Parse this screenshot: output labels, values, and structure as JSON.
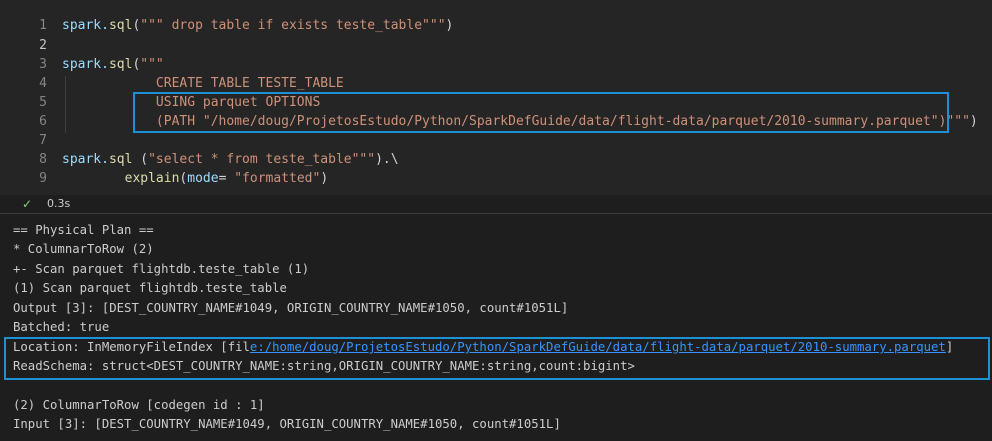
{
  "cell": {
    "lines": [
      {
        "n": "1",
        "parts": [
          {
            "t": "spark.",
            "c": "id"
          },
          {
            "t": "sql",
            "c": "fn"
          },
          {
            "t": "(",
            "c": "pn"
          },
          {
            "t": "\"\"\" drop table if exists teste_table\"\"\"",
            "c": "st"
          },
          {
            "t": ")",
            "c": "pn"
          }
        ]
      },
      {
        "n": "2",
        "parts": []
      },
      {
        "n": "3",
        "parts": [
          {
            "t": "spark.",
            "c": "id"
          },
          {
            "t": "sql",
            "c": "fn"
          },
          {
            "t": "(",
            "c": "pn"
          },
          {
            "t": "\"\"\"",
            "c": "st"
          }
        ]
      },
      {
        "n": "4",
        "parts": [
          {
            "t": "            CREATE TABLE TESTE_TABLE",
            "c": "st"
          }
        ]
      },
      {
        "n": "5",
        "parts": [
          {
            "t": "            USING parquet OPTIONS",
            "c": "st"
          }
        ]
      },
      {
        "n": "6",
        "parts": [
          {
            "t": "            (PATH \"/home/doug/ProjetosEstudo/Python/SparkDefGuide/data/flight-data/parquet/2010-summary.parquet\")\"\"\"",
            "c": "st"
          },
          {
            "t": ")",
            "c": "pn"
          }
        ]
      },
      {
        "n": "7",
        "parts": []
      },
      {
        "n": "8",
        "parts": [
          {
            "t": "spark.",
            "c": "id"
          },
          {
            "t": "sql",
            "c": "fn"
          },
          {
            "t": " (",
            "c": "pn"
          },
          {
            "t": "\"select * from teste_table\"\"\"",
            "c": "st"
          },
          {
            "t": ").\\",
            "c": "pn"
          }
        ]
      },
      {
        "n": "9",
        "parts": [
          {
            "t": "        ",
            "c": "pn"
          },
          {
            "t": "explain",
            "c": "fn"
          },
          {
            "t": "(",
            "c": "pn"
          },
          {
            "t": "mode",
            "c": "id"
          },
          {
            "t": "= ",
            "c": "pn"
          },
          {
            "t": "\"formatted\"",
            "c": "st"
          },
          {
            "t": ")",
            "c": "pn"
          }
        ]
      }
    ],
    "active_line": "2"
  },
  "status": {
    "check_icon": "check-icon",
    "elapsed": "0.3s"
  },
  "output": {
    "lines": [
      "== Physical Plan ==",
      "* ColumnarToRow (2)",
      "+- Scan parquet flightdb.teste_table (1)",
      "(1) Scan parquet flightdb.teste_table",
      "Output [3]: [DEST_COUNTRY_NAME#1049, ORIGIN_COUNTRY_NAME#1050, count#1051L]",
      "Batched: true",
      "ReadSchema: struct<DEST_COUNTRY_NAME:string,ORIGIN_COUNTRY_NAME:string,count:bigint>",
      "",
      "(2) ColumnarToRow [codegen id : 1]",
      "Input [3]: [DEST_COUNTRY_NAME#1049, ORIGIN_COUNTRY_NAME#1050, count#1051L]"
    ],
    "location_prefix": "Location: InMemoryFileIndex [fil",
    "location_link": "e:/home/doug/ProjetosEstudo/Python/SparkDefGuide/data/flight-data/parquet/2010-summary.parquet",
    "location_suffix": "]"
  },
  "colors": {
    "highlight_box": "#1e90d6",
    "link": "#3794ff",
    "string": "#ce9178"
  }
}
